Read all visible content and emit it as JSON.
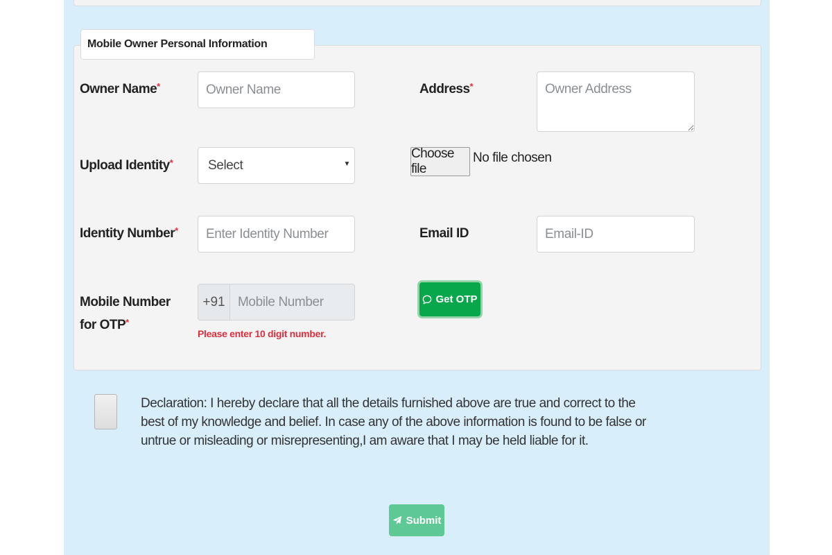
{
  "section": {
    "title": "Mobile Owner Personal Information"
  },
  "fields": {
    "owner_name": {
      "label": "Owner Name",
      "required": "*",
      "placeholder": "Owner Name"
    },
    "address": {
      "label": "Address",
      "required": "*",
      "placeholder": "Owner Address"
    },
    "upload_identity": {
      "label": "Upload Identity",
      "required": "*",
      "selected": "Select"
    },
    "file": {
      "button_label": "Choose file",
      "status": "No file chosen"
    },
    "identity_number": {
      "label": "Identity Number",
      "required": "*",
      "placeholder": "Enter Identity Number"
    },
    "email": {
      "label": "Email ID",
      "placeholder": "Email-ID"
    },
    "mobile": {
      "label": "Mobile Number for OTP",
      "required": "*",
      "prefix": "+91",
      "placeholder": "Mobile Number",
      "error": "Please enter 10 digit number."
    }
  },
  "buttons": {
    "get_otp": "Get OTP",
    "submit": "Submit"
  },
  "declaration": "Declaration: I hereby declare that all the details furnished above are true and correct to the best of my knowledge and belief. In case any of the above information is found to be false or untrue or misleading or misrepresenting,I am aware that I may be held liable for it.",
  "icons": {
    "otp": "chat-bubble-icon",
    "submit": "paper-plane-icon"
  },
  "colors": {
    "page_background": "#d9eefb",
    "panel_background": "#f4f4f4",
    "required_mark": "#e0313a",
    "error_text": "#dc2f3d",
    "otp_button": "#08a74b",
    "submit_button": "#5ec994"
  }
}
